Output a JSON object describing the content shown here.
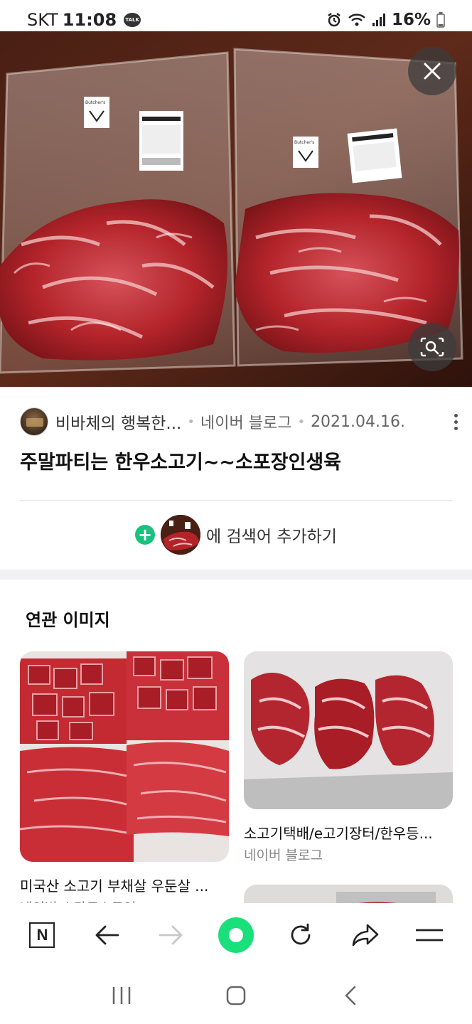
{
  "status_bar": {
    "carrier": "SKT",
    "time": "11:08",
    "talk_badge": "TALK",
    "battery_percent": "16%"
  },
  "hero": {
    "package_label_left": "Butcher's",
    "package_label_right": "Butcher's"
  },
  "info": {
    "source_name": "비바체의 행복한...",
    "platform": "네이버 블로그",
    "date": "2021.04.16.",
    "title": "주말파티는 한우소고기~~소포장인생육"
  },
  "add_search": {
    "plus": "+",
    "label": "에 검색어 추가하기"
  },
  "related": {
    "heading": "연관 이미지",
    "cards": [
      {
        "title": "미국산 소고기 부채살 우둔살 ...",
        "source": "네이버 스마트스토어",
        "badge": ""
      },
      {
        "title": "소고기택배/e고기장터/한우등...",
        "source": "네이버 블로그"
      }
    ]
  },
  "toolbar": {
    "home_label": "N"
  },
  "colors": {
    "accent_green": "#19c37d",
    "ring_green": "#19e07a",
    "meat_red": "#b3242a"
  }
}
